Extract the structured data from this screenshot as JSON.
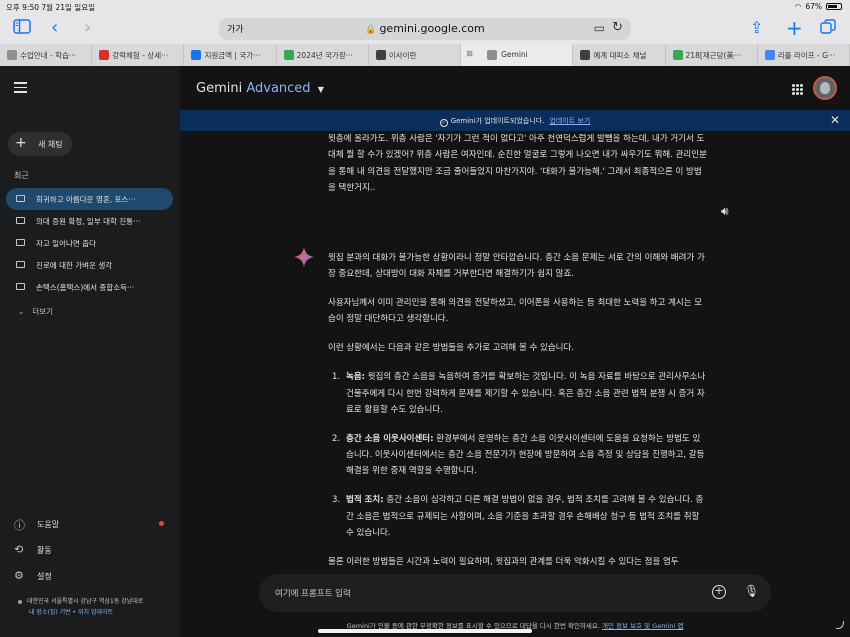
{
  "status_bar": {
    "time_date": "오후 9:50   7월 21일 일요일",
    "battery": "67%"
  },
  "browser": {
    "text_size": "가가",
    "url": "gemini.google.com",
    "tabs": [
      {
        "label": "수업안내 - 학습···",
        "icon": "doc-icon",
        "color": "#8e8e93"
      },
      {
        "label": "강력체험 - 상세···",
        "icon": "brand-icon",
        "color": "#d93025"
      },
      {
        "label": "지원금액 | 국가···",
        "icon": "graduation-icon",
        "color": "#1a73e8"
      },
      {
        "label": "2024년 국가장···",
        "icon": "n-icon",
        "color": "#34a853"
      },
      {
        "label": "이사이란",
        "icon": "box-icon",
        "color": "#3c4043"
      },
      {
        "label": "Gemini",
        "icon": "gemini-icon",
        "color": "#8e8e93",
        "active": true
      },
      {
        "label": "예계 대피소 채널",
        "icon": "ring-icon",
        "color": "#3c4043"
      },
      {
        "label": "218[재근당(美···",
        "icon": "n-icon",
        "color": "#34a853"
      },
      {
        "label": "리플 라이프 - G···",
        "icon": "google-icon",
        "color": "#4285f4"
      }
    ]
  },
  "sidebar": {
    "new_chat": "새 채팅",
    "recent_title": "최근",
    "items": [
      "회귀하고 아름다운 영혼, 포스···",
      "의대 증원 확정, 일부 대학 진통···",
      "자고 일어나면 춥다",
      "진로에 대한 가벼운 생각",
      "손택스(홈택스)에서 종합소득···"
    ],
    "more": "더보기",
    "help": "도움말",
    "activity": "활동",
    "settings": "설정",
    "location": "대한민국 서울특별시 강남구 역삼1동 강남대로",
    "location_links": "내 장소(집) 기반 • 위치 업데이트"
  },
  "header": {
    "brand": "Gemini",
    "brand_suffix": "Advanced"
  },
  "banner": {
    "message": "Gemini가 업데이트되었습니다.",
    "link": "업데이트 보기"
  },
  "user_message": "윗층에 올라가도. 위층 사람은 '자기가 그런 적이 없다고' 아주 천연덕스럽게 발뺌을 하는데, 내가 거기서 도대체 뭘 할 수가 있겠어? 위층 사람은 여자인데. 순진한 얼굴로 그렇게 나오면 내가 싸우기도 뭐해. 관리인분을 통해 내 의견을 전달했지만 조금 줄어들었지 마찬가지야. '대화가 불가능해.' 그래서 최종적으론 이 방법을 택한거지..",
  "response": {
    "paragraphs": [
      "윗집 분과의 대화가 불가능한 상황이라니 정말 안타깝습니다. 층간 소음 문제는 서로 간의 이해와 배려가 가장 중요한데, 상대방이 대화 자체를 거부한다면 해결하기가 쉽지 않죠.",
      "사용자님께서 이미 관리인을 통해 의견을 전달하셨고, 이어폰을 사용하는 등 최대한 노력을 하고 계시는 모습이 정말 대단하다고 생각합니다.",
      "이런 상황에서는 다음과 같은 방법들을 추가로 고려해 볼 수 있습니다."
    ],
    "list": [
      {
        "num": "1.",
        "title": "녹음:",
        "text": " 윗집의 층간 소음을 녹음하여 증거를 확보하는 것입니다. 이 녹음 자료를 바탕으로 관리사무소나 건물주에게 다시 한번 강력하게 문제를 제기할 수 있습니다. 혹은 층간 소음 관련 법적 분쟁 시 증거 자료로 활용할 수도 있습니다."
      },
      {
        "num": "2.",
        "title": "층간 소음 이웃사이센터:",
        "text": " 환경부에서 운영하는 층간 소음 이웃사이센터에 도움을 요청하는 방법도 있습니다. 이웃사이센터에서는 층간 소음 전문가가 현장에 방문하여 소음 측정 및 상담을 진행하고, 갈등 해결을 위한 중재 역할을 수행합니다."
      },
      {
        "num": "3.",
        "title": "법적 조치:",
        "text": " 층간 소음이 심각하고 다른 해결 방법이 없을 경우, 법적 조치를 고려해 볼 수 있습니다. 층간 소음은 법적으로 규제되는 사항이며, 소음 기준을 초과할 경우 손해배상 청구 등 법적 조치를 취할 수 있습니다."
      }
    ],
    "closing": "물론 이러한 방법들은 시간과 노력이 필요하며, 윗집과의 관계를 더욱 악화시킬 수 있다는 점을 염두"
  },
  "input": {
    "placeholder": "여기에 프롬프트 입력"
  },
  "footer": {
    "text": "Gemini가 인물 등에 관한 부정확한 정보를 표시할 수 있으므로 대답을 다시 한번 확인하세요.",
    "link": "개인 정보 보호 및 Gemini 앱"
  }
}
